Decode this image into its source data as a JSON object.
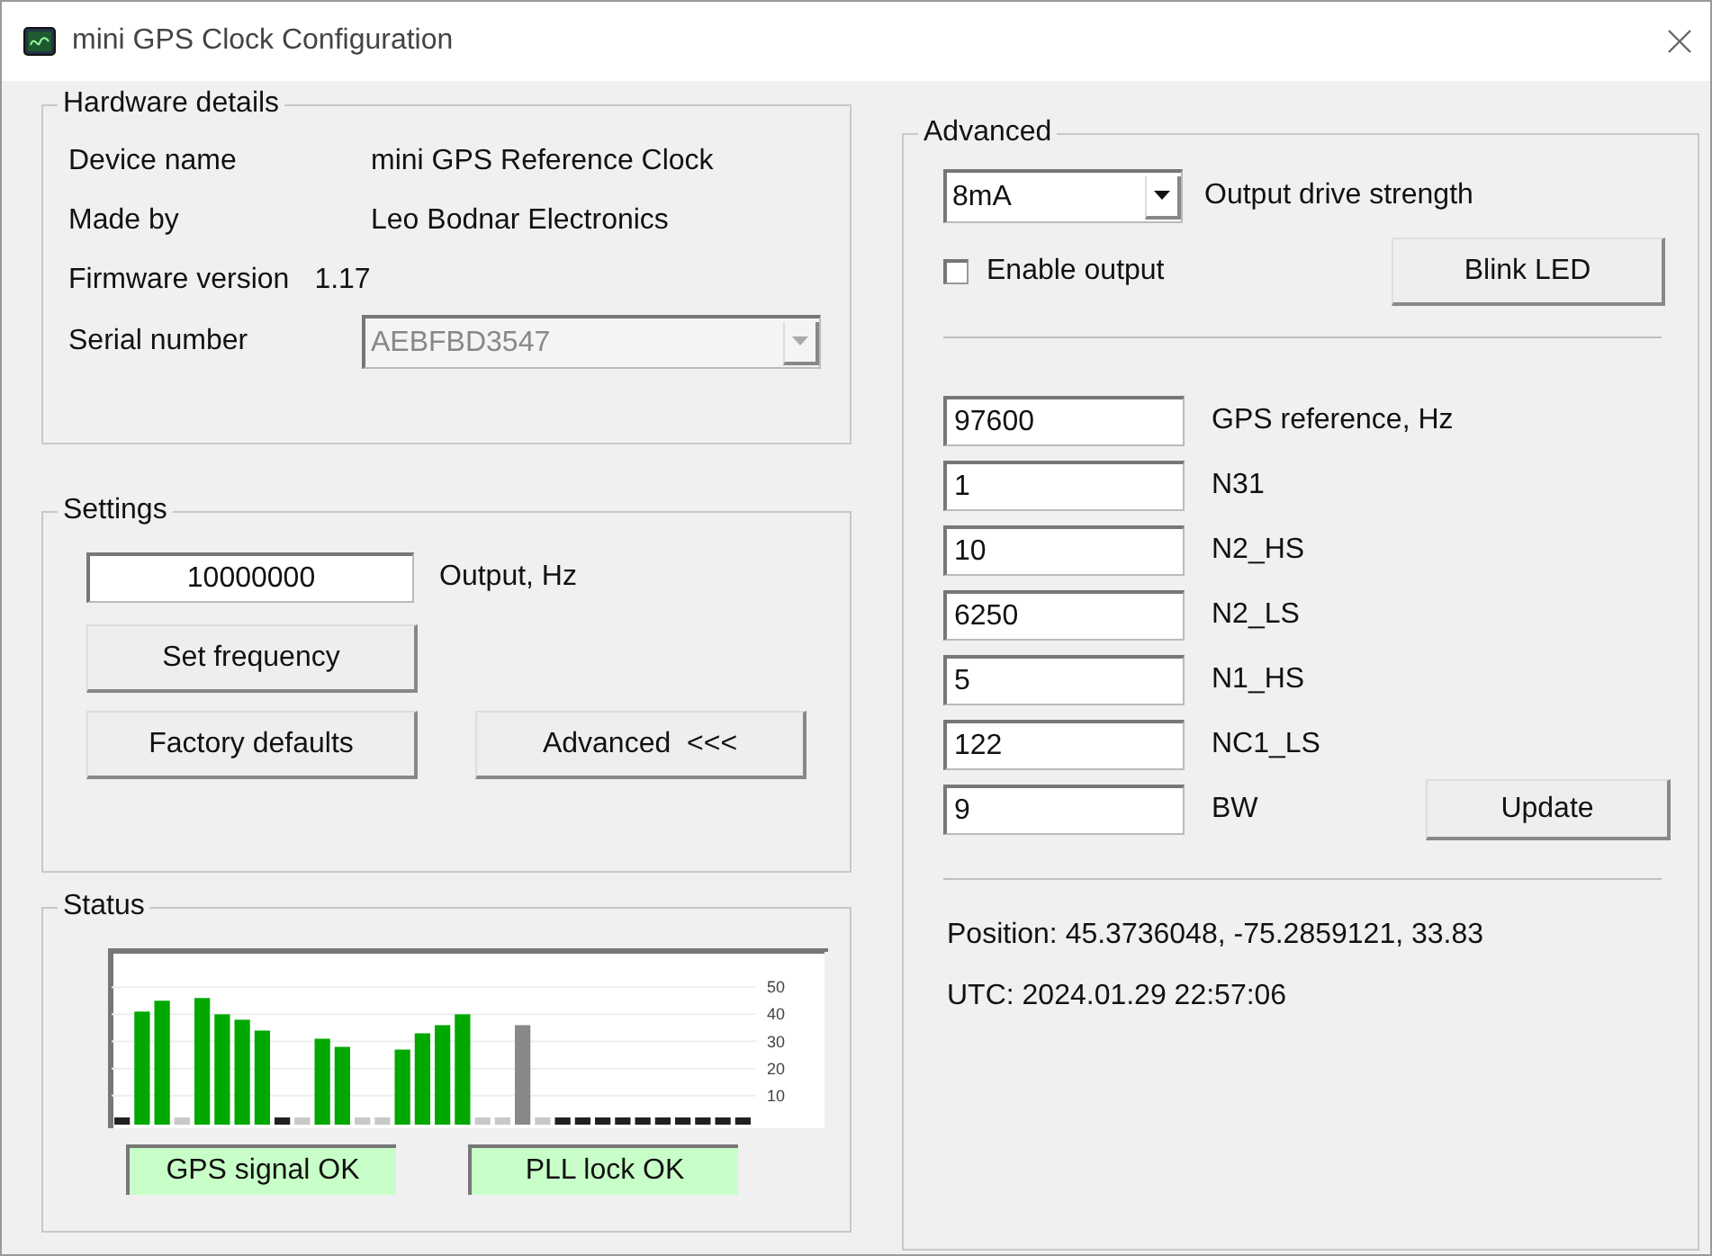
{
  "window": {
    "title": "mini GPS Clock Configuration"
  },
  "hardware": {
    "title": "Hardware details",
    "rows": [
      {
        "label": "Device name",
        "value": "mini GPS Reference Clock"
      },
      {
        "label": "Made by",
        "value": "Leo Bodnar Electronics"
      },
      {
        "label": "Firmware version",
        "value": "1.17"
      }
    ],
    "serial": {
      "label": "Serial number",
      "value": "AEBFBD3547",
      "disabled": true
    }
  },
  "settings": {
    "title": "Settings",
    "frequency": {
      "value": "10000000",
      "label": "Output, Hz"
    },
    "buttons": [
      "Set frequency",
      "Factory defaults",
      "Advanced  <<<"
    ]
  },
  "status": {
    "title": "Status",
    "chart_data": {
      "type": "bar",
      "grid": true,
      "ylim": [
        0,
        63
      ],
      "yticks": [
        10,
        20,
        30,
        40,
        50
      ],
      "series": [
        {
          "color": "#00a800",
          "values": [
            null,
            41,
            45,
            null,
            46,
            40,
            38,
            34,
            null,
            null,
            31,
            28,
            null,
            null,
            27,
            33,
            36,
            40,
            null,
            null,
            null,
            null,
            null,
            null,
            null,
            null,
            null,
            null,
            null,
            null,
            null,
            null
          ]
        },
        {
          "color": "#888888",
          "values": [
            null,
            null,
            null,
            null,
            null,
            null,
            null,
            null,
            null,
            null,
            null,
            null,
            null,
            null,
            null,
            null,
            null,
            null,
            null,
            null,
            36,
            null,
            null,
            null,
            null,
            null,
            null,
            null,
            null,
            null,
            null,
            null
          ]
        },
        {
          "color": "#202020",
          "values": [
            0,
            null,
            null,
            null,
            null,
            null,
            null,
            null,
            0,
            null,
            null,
            null,
            null,
            null,
            null,
            null,
            null,
            null,
            null,
            null,
            null,
            null,
            0,
            0,
            0,
            0,
            0,
            0,
            0,
            0,
            0,
            0
          ]
        },
        {
          "color": "#c8c8c8",
          "values": [
            null,
            null,
            null,
            0,
            null,
            null,
            null,
            null,
            null,
            0,
            null,
            null,
            0,
            0,
            null,
            null,
            null,
            null,
            0,
            0,
            null,
            0,
            null,
            null,
            null,
            null,
            null,
            null,
            null,
            null,
            null,
            null
          ]
        }
      ]
    },
    "indicators": [
      {
        "label": "GPS signal OK",
        "on": true
      },
      {
        "label": "PLL lock OK",
        "on": true
      }
    ]
  },
  "advanced": {
    "title": "Advanced",
    "drive": {
      "value": "8mA",
      "label": "Output drive strength"
    },
    "enable_output": {
      "label": "Enable output",
      "checked": false
    },
    "blink_button": "Blink LED",
    "params": [
      {
        "value": "97600",
        "label": "GPS reference, Hz"
      },
      {
        "value": "1",
        "label": "N31"
      },
      {
        "value": "10",
        "label": "N2_HS"
      },
      {
        "value": "6250",
        "label": "N2_LS"
      },
      {
        "value": "5",
        "label": "N1_HS"
      },
      {
        "value": "122",
        "label": "NC1_LS"
      },
      {
        "value": "9",
        "label": "BW"
      }
    ],
    "update_button": "Update",
    "position": "Position: 45.3736048, -75.2859121, 33.83",
    "utc": "UTC: 2024.01.29 22:57:06"
  }
}
